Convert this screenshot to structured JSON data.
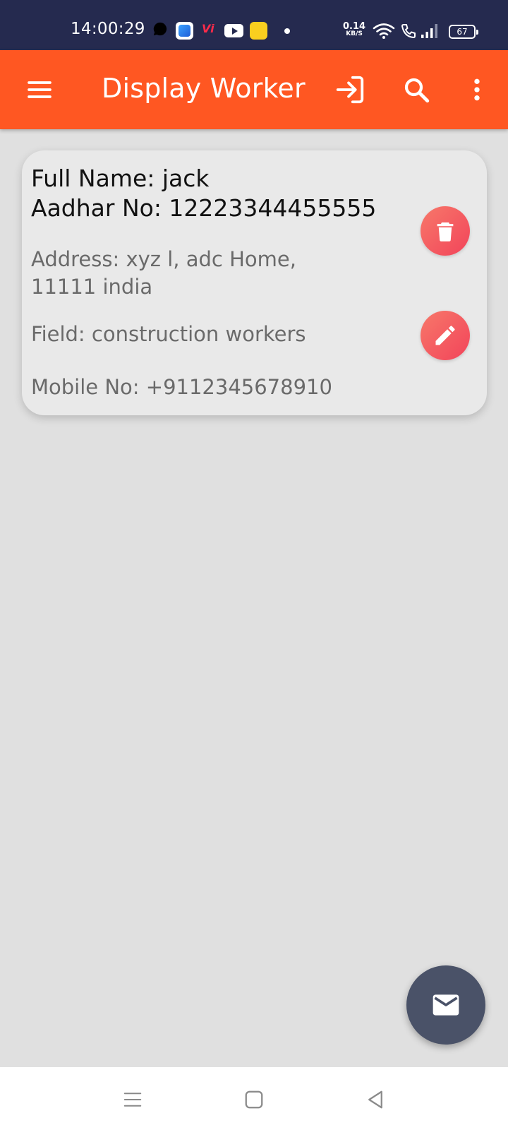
{
  "status_bar": {
    "time": "14:00:29",
    "carrier_icon_text": "Vi",
    "net_speed_value": "0.14",
    "net_speed_unit": "KB/S",
    "battery_level": "67",
    "icons": [
      "whatsapp-icon",
      "app-icon",
      "vi-icon",
      "youtube-icon",
      "app-icon",
      "dot-icon",
      "wifi-icon",
      "wifi-call-icon",
      "signal-icon",
      "battery-icon"
    ]
  },
  "toolbar": {
    "title": "Display Worker",
    "background_color": "#ff5722",
    "icons": [
      "menu-icon",
      "login-icon",
      "search-icon",
      "more-vert-icon"
    ]
  },
  "worker_card": {
    "full_name": "Full Name: jack",
    "aadhar": "Aadhar No: 12223344455555",
    "address": "Address: xyz l, adc Home, 11111 india",
    "field": "Field: construction workers",
    "mobile": "Mobile No: +9112345678910",
    "button_color": "#f2445a",
    "icons": [
      "delete-icon",
      "edit-icon"
    ]
  },
  "fab": {
    "icon": "mail-icon",
    "color": "#4a5268"
  },
  "nav_bar": {
    "icons": [
      "recents-icon",
      "home-icon",
      "back-icon"
    ]
  }
}
